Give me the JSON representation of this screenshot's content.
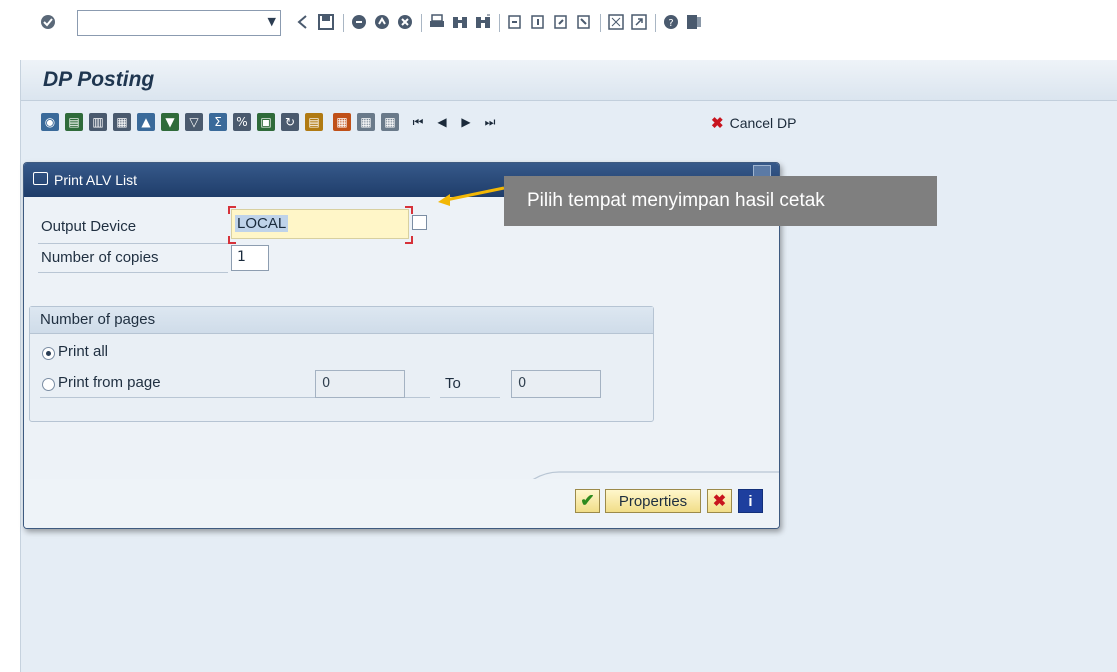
{
  "page": {
    "title": "DP Posting"
  },
  "system_toolbar": {
    "command_field_value": "",
    "icons": [
      "enter-icon",
      "back-icon",
      "save-icon",
      "exit-icon",
      "cancel-icon",
      "stop-icon",
      "print-icon",
      "find-icon",
      "find-next-icon",
      "first-page-icon",
      "previous-page-icon",
      "next-page-icon",
      "last-page-icon",
      "new-session-icon",
      "shortcut-icon",
      "help-icon",
      "layout-menu-icon"
    ]
  },
  "app_toolbar": {
    "cancel_label": "Cancel DP"
  },
  "dialog": {
    "title": "Print ALV List",
    "output_device_label": "Output Device",
    "output_device_value": "LOCAL",
    "copies_label": "Number of copies",
    "copies_value": "1",
    "pages_group_title": "Number of pages",
    "print_all_label": "Print all",
    "print_from_label": "Print from page",
    "from_value": "0",
    "to_label": "To",
    "to_value": "0",
    "properties_label": "Properties",
    "print_all_selected": true
  },
  "annotation": {
    "text": "Pilih tempat menyimpan hasil cetak",
    "arrow_color": "#f2b705"
  },
  "colors": {
    "accent": "#1f3d6a",
    "tooltip_bg": "#7f7f7f"
  }
}
